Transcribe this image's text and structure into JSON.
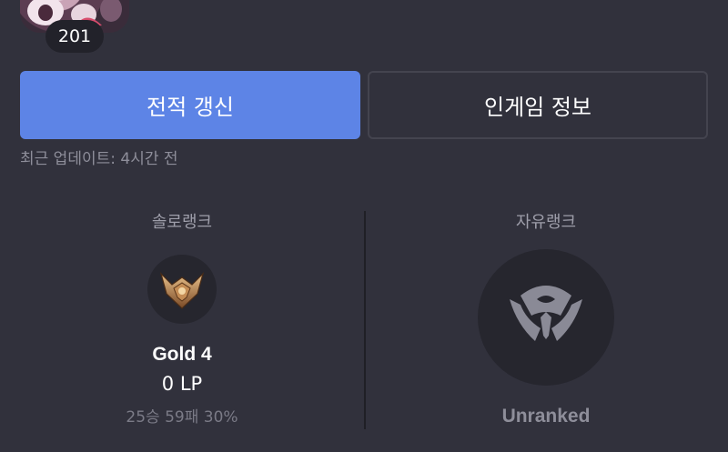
{
  "profile": {
    "level": "201",
    "avatar_icon": "champion-portrait-icon"
  },
  "actions": {
    "refresh_label": "전적 갱신",
    "ingame_label": "인게임 정보",
    "last_update": "최근 업데이트: 4시간 전"
  },
  "ranks": {
    "solo": {
      "title": "솔로랭크",
      "emblem_icon": "gold-emblem-icon",
      "tier": "Gold 4",
      "lp": "0 LP",
      "record": "25승 59패 30%"
    },
    "flex": {
      "title": "자유랭크",
      "emblem_icon": "unranked-emblem-icon",
      "tier": "Unranked"
    }
  },
  "colors": {
    "background": "#31313c",
    "accent_button": "#5d84e6",
    "muted_text": "#8e8e9a"
  }
}
